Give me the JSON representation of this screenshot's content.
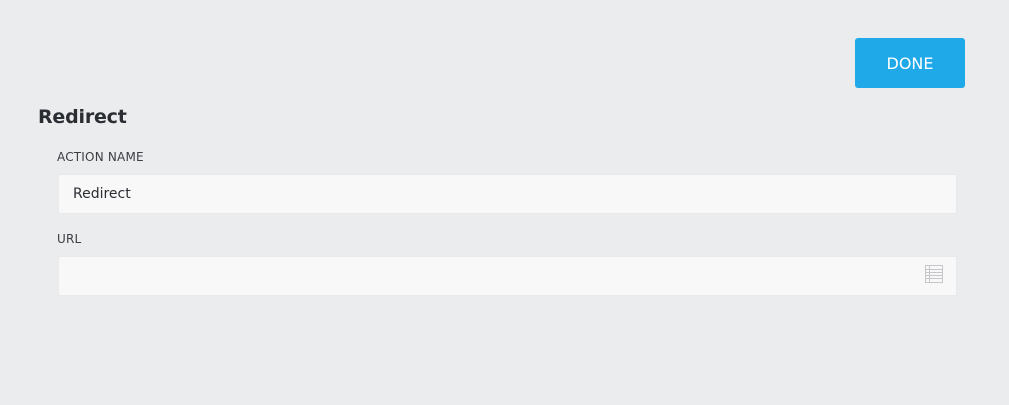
{
  "header": {
    "done_label": "DONE"
  },
  "section": {
    "title": "Redirect"
  },
  "fields": {
    "action_name": {
      "label": "ACTION NAME",
      "value": "Redirect"
    },
    "url": {
      "label": "URL",
      "value": "",
      "icon": "list-icon"
    }
  },
  "colors": {
    "accent": "#1fa9e8",
    "background": "#ebecee",
    "input_background": "#f8f8f8"
  }
}
